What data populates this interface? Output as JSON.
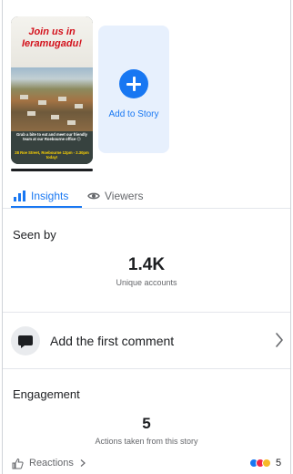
{
  "story": {
    "thumb_title": "Join us in Ieramugadu!",
    "thumb_body": "Grab a bite to eat and meet our friendly team at our Roebourne office 😊",
    "thumb_address": "28 Roe Street, Roebourne 12pm - 2.30pm today!",
    "add_label": "Add to Story"
  },
  "tabs": {
    "insights": "Insights",
    "viewers": "Viewers"
  },
  "seen_by": {
    "title": "Seen by",
    "count": "1.4K",
    "caption": "Unique accounts"
  },
  "comment": {
    "label": "Add the first comment"
  },
  "engagement": {
    "title": "Engagement",
    "count": "5",
    "caption": "Actions taken from this story"
  },
  "reactions": {
    "label": "Reactions",
    "count": "5",
    "icons": [
      "like-icon",
      "love-icon",
      "haha-icon"
    ]
  },
  "colors": {
    "accent": "#1877f2",
    "add_card_bg": "#e7f0fd"
  }
}
